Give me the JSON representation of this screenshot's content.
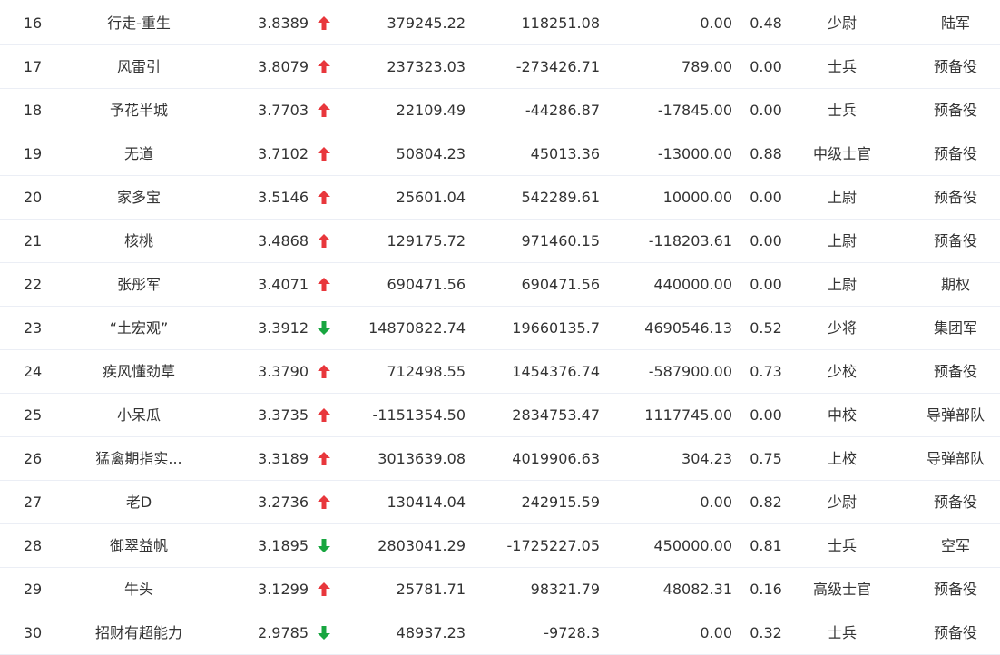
{
  "colors": {
    "up": "#e8373c",
    "down": "#18a640",
    "text": "#333333",
    "row_border": "#ebeef5"
  },
  "rows": [
    {
      "rank": "16",
      "name": "行走-重生",
      "score": "3.8389",
      "trend": "up",
      "trend_icon": "arrow-up-icon",
      "v1": "379245.22",
      "v2": "118251.08",
      "v3": "0.00",
      "ratio": "0.48",
      "title": "少尉",
      "branch": "陆军"
    },
    {
      "rank": "17",
      "name": "风雷引",
      "score": "3.8079",
      "trend": "up",
      "trend_icon": "arrow-up-icon",
      "v1": "237323.03",
      "v2": "-273426.71",
      "v3": "789.00",
      "ratio": "0.00",
      "title": "士兵",
      "branch": "预备役"
    },
    {
      "rank": "18",
      "name": "予花半城",
      "score": "3.7703",
      "trend": "up",
      "trend_icon": "arrow-up-icon",
      "v1": "22109.49",
      "v2": "-44286.87",
      "v3": "-17845.00",
      "ratio": "0.00",
      "title": "士兵",
      "branch": "预备役"
    },
    {
      "rank": "19",
      "name": "无道",
      "score": "3.7102",
      "trend": "up",
      "trend_icon": "arrow-up-icon",
      "v1": "50804.23",
      "v2": "45013.36",
      "v3": "-13000.00",
      "ratio": "0.88",
      "title": "中级士官",
      "branch": "预备役"
    },
    {
      "rank": "20",
      "name": "家多宝",
      "score": "3.5146",
      "trend": "up",
      "trend_icon": "arrow-up-icon",
      "v1": "25601.04",
      "v2": "542289.61",
      "v3": "10000.00",
      "ratio": "0.00",
      "title": "上尉",
      "branch": "预备役"
    },
    {
      "rank": "21",
      "name": "核桃",
      "score": "3.4868",
      "trend": "up",
      "trend_icon": "arrow-up-icon",
      "v1": "129175.72",
      "v2": "971460.15",
      "v3": "-118203.61",
      "ratio": "0.00",
      "title": "上尉",
      "branch": "预备役"
    },
    {
      "rank": "22",
      "name": "张彤军",
      "score": "3.4071",
      "trend": "up",
      "trend_icon": "arrow-up-icon",
      "v1": "690471.56",
      "v2": "690471.56",
      "v3": "440000.00",
      "ratio": "0.00",
      "title": "上尉",
      "branch": "期权"
    },
    {
      "rank": "23",
      "name": "“土宏观”",
      "score": "3.3912",
      "trend": "down",
      "trend_icon": "arrow-down-icon",
      "v1": "14870822.74",
      "v2": "19660135.7",
      "v3": "4690546.13",
      "ratio": "0.52",
      "title": "少将",
      "branch": "集团军"
    },
    {
      "rank": "24",
      "name": "疾风懂劲草",
      "score": "3.3790",
      "trend": "up",
      "trend_icon": "arrow-up-icon",
      "v1": "712498.55",
      "v2": "1454376.74",
      "v3": "-587900.00",
      "ratio": "0.73",
      "title": "少校",
      "branch": "预备役"
    },
    {
      "rank": "25",
      "name": "小呆瓜",
      "score": "3.3735",
      "trend": "up",
      "trend_icon": "arrow-up-icon",
      "v1": "-1151354.50",
      "v2": "2834753.47",
      "v3": "1117745.00",
      "ratio": "0.00",
      "title": "中校",
      "branch": "导弹部队"
    },
    {
      "rank": "26",
      "name": "猛禽期指实...",
      "score": "3.3189",
      "trend": "up",
      "trend_icon": "arrow-up-icon",
      "v1": "3013639.08",
      "v2": "4019906.63",
      "v3": "304.23",
      "ratio": "0.75",
      "title": "上校",
      "branch": "导弹部队"
    },
    {
      "rank": "27",
      "name": "老D",
      "score": "3.2736",
      "trend": "up",
      "trend_icon": "arrow-up-icon",
      "v1": "130414.04",
      "v2": "242915.59",
      "v3": "0.00",
      "ratio": "0.82",
      "title": "少尉",
      "branch": "预备役"
    },
    {
      "rank": "28",
      "name": "御翠益帆",
      "score": "3.1895",
      "trend": "down",
      "trend_icon": "arrow-down-icon",
      "v1": "2803041.29",
      "v2": "-1725227.05",
      "v3": "450000.00",
      "ratio": "0.81",
      "title": "士兵",
      "branch": "空军"
    },
    {
      "rank": "29",
      "name": "牛头",
      "score": "3.1299",
      "trend": "up",
      "trend_icon": "arrow-up-icon",
      "v1": "25781.71",
      "v2": "98321.79",
      "v3": "48082.31",
      "ratio": "0.16",
      "title": "高级士官",
      "branch": "预备役"
    },
    {
      "rank": "30",
      "name": "招财有超能力",
      "score": "2.9785",
      "trend": "down",
      "trend_icon": "arrow-down-icon",
      "v1": "48937.23",
      "v2": "-9728.3",
      "v3": "0.00",
      "ratio": "0.32",
      "title": "士兵",
      "branch": "预备役"
    }
  ]
}
